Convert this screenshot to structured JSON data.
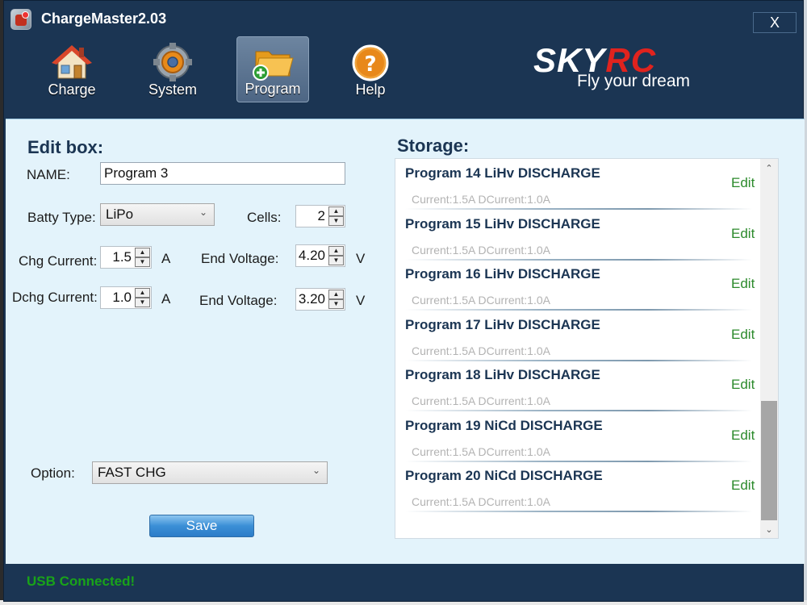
{
  "window": {
    "title": "ChargeMaster2.03",
    "close_label": "X"
  },
  "toolbar": {
    "items": [
      {
        "label": "Charge",
        "icon": "house-icon"
      },
      {
        "label": "System",
        "icon": "gear-icon"
      },
      {
        "label": "Program",
        "icon": "folder-add-icon",
        "active": true
      },
      {
        "label": "Help",
        "icon": "help-icon"
      }
    ]
  },
  "logo": {
    "brand_sky": "SKY",
    "brand_rc": "RC",
    "tagline": "Fly your dream"
  },
  "edit_box": {
    "title": "Edit box:",
    "name_label": "NAME:",
    "name_value": "Program 3",
    "batty_type_label": "Batty Type:",
    "batty_type_value": "LiPo",
    "cells_label": "Cells:",
    "cells_value": "2",
    "chg_current_label": "Chg Current:",
    "chg_current_value": "1.5",
    "chg_current_unit": "A",
    "chg_end_voltage_label": "End Voltage:",
    "chg_end_voltage_value": "4.20",
    "chg_end_voltage_unit": "V",
    "dchg_current_label": "Dchg Current:",
    "dchg_current_value": "1.0",
    "dchg_current_unit": "A",
    "dchg_end_voltage_label": "End Voltage:",
    "dchg_end_voltage_value": "3.20",
    "dchg_end_voltage_unit": "V",
    "option_label": "Option:",
    "option_value": "FAST CHG",
    "save_label": "Save"
  },
  "storage": {
    "title": "Storage:",
    "items": [
      {
        "title": "Program 14 LiHv DISCHARGE",
        "sub": "Current:1.5A  DCurrent:1.0A",
        "edit": "Edit"
      },
      {
        "title": "Program 15 LiHv DISCHARGE",
        "sub": "Current:1.5A  DCurrent:1.0A",
        "edit": "Edit"
      },
      {
        "title": "Program 16 LiHv DISCHARGE",
        "sub": "Current:1.5A  DCurrent:1.0A",
        "edit": "Edit"
      },
      {
        "title": "Program 17 LiHv DISCHARGE",
        "sub": "Current:1.5A  DCurrent:1.0A",
        "edit": "Edit"
      },
      {
        "title": "Program 18 LiHv DISCHARGE",
        "sub": "Current:1.5A  DCurrent:1.0A",
        "edit": "Edit"
      },
      {
        "title": "Program 19 NiCd DISCHARGE",
        "sub": "Current:1.5A  DCurrent:1.0A",
        "edit": "Edit"
      },
      {
        "title": "Program 20 NiCd DISCHARGE",
        "sub": "Current:1.5A  DCurrent:1.0A",
        "edit": "Edit"
      }
    ]
  },
  "status": {
    "text": "USB  Connected!"
  },
  "colors": {
    "window_bg": "#1b3553",
    "panel_bg": "#e3f3fb",
    "status_green": "#19a319",
    "edit_green": "#2b8a2b",
    "brand_red": "#e0231e"
  }
}
